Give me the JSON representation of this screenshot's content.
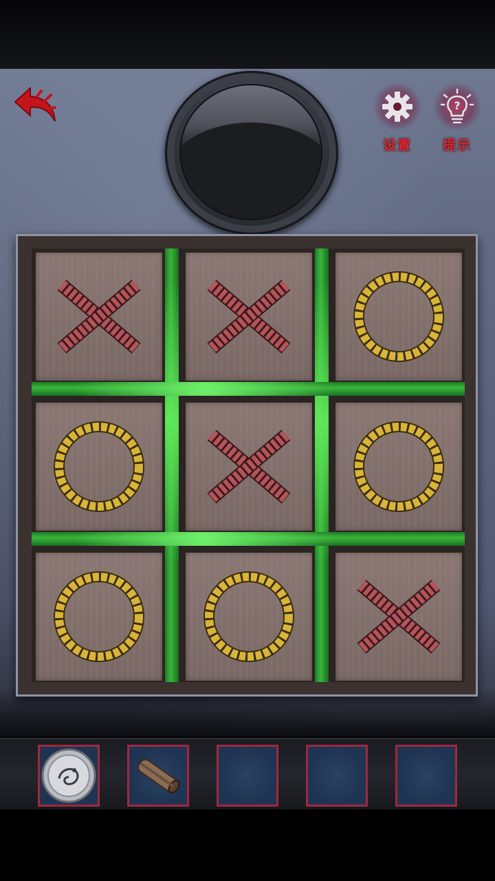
{
  "header": {
    "settings_label": "设置",
    "hint_label": "提示"
  },
  "board": {
    "cells": [
      "X",
      "X",
      "O",
      "O",
      "X",
      "O",
      "O",
      "O",
      "X"
    ]
  },
  "colors": {
    "x_mark": "#b5545a",
    "o_mark": "#d9b43a",
    "grid_glow": "#3cc13a",
    "accent_red": "#e0262e",
    "slot_border": "#a0283c"
  },
  "icons": {
    "back": "back-arrow-icon",
    "settings": "gear-icon",
    "hint": "lightbulb-icon"
  },
  "inventory": {
    "slots": [
      "silver-plate",
      "rolled-scroll",
      "empty",
      "empty",
      "empty"
    ]
  }
}
